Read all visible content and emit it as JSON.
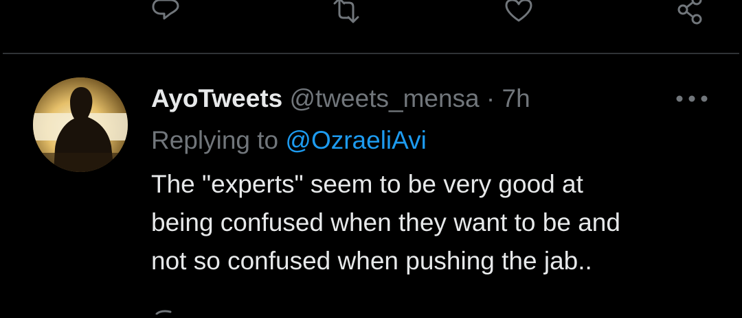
{
  "previous_tweet_actions": {
    "icons": [
      "reply-icon",
      "retweet-icon",
      "like-icon",
      "share-icon"
    ]
  },
  "tweet": {
    "display_name": "AyoTweets",
    "handle": "@tweets_mensa",
    "separator": "·",
    "time": "7h",
    "replying_prefix": "Replying to",
    "replying_to": "@OzraeliAvi",
    "text_lines": [
      "The \"experts\" seem to be very good at",
      "being confused when they want to be and",
      "not so confused when pushing the jab.."
    ]
  },
  "colors": {
    "background": "#000000",
    "primary_text": "#e7e9ea",
    "secondary_text": "#71767b",
    "accent": "#1d9bf0",
    "divider": "#2f3336"
  }
}
